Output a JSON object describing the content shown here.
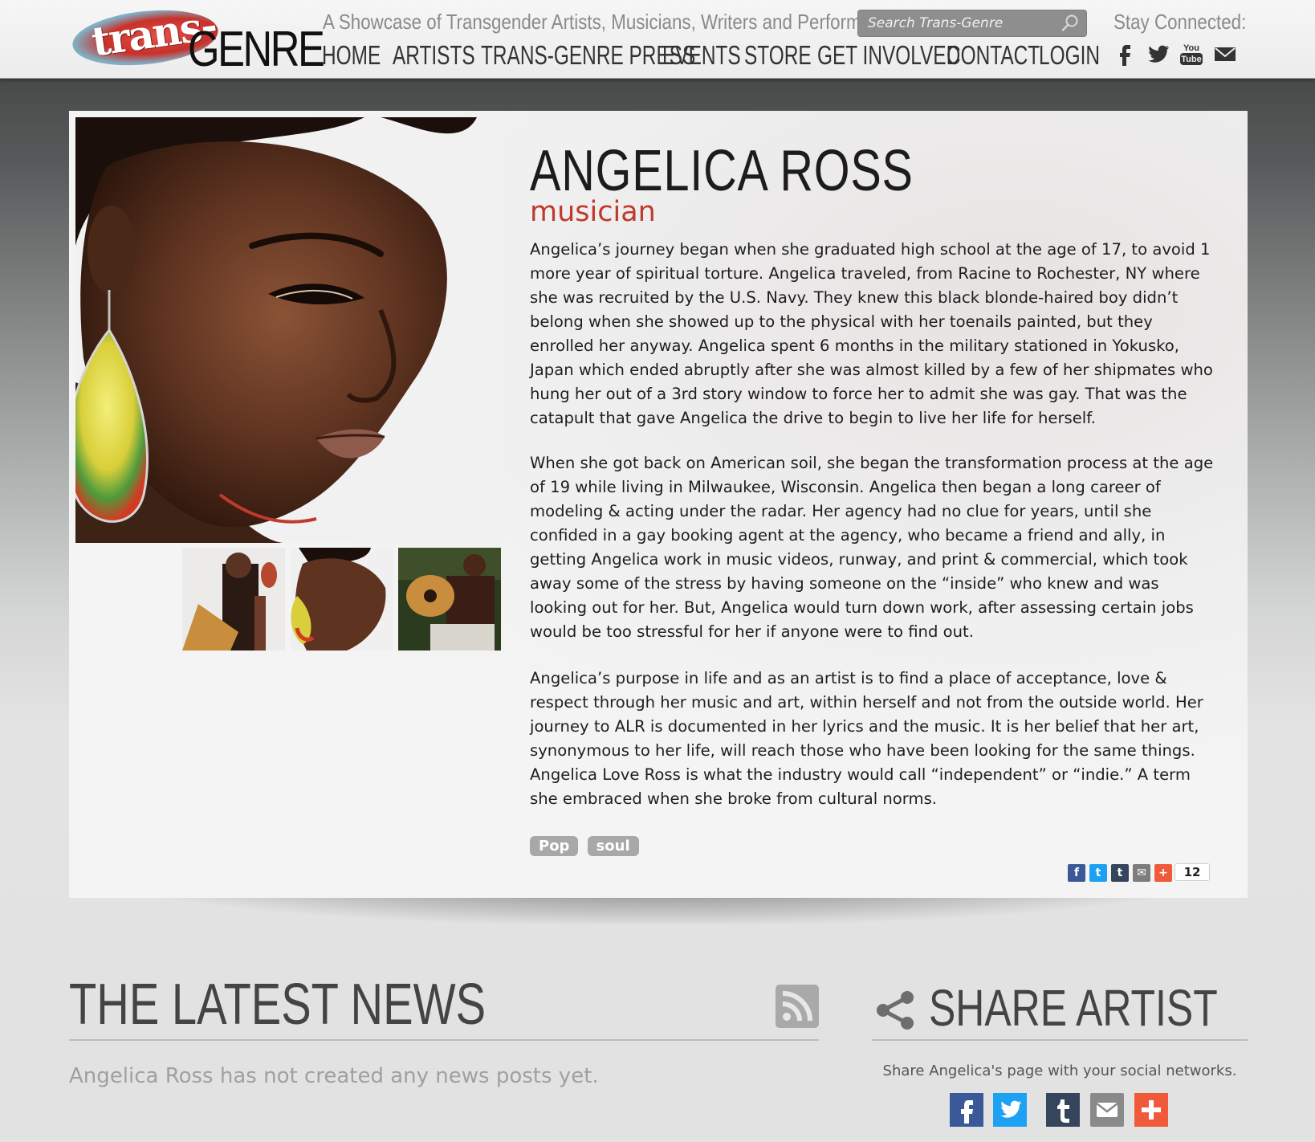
{
  "header": {
    "logo_alt": "trans-GENRE",
    "logo_text_trans": "trans-",
    "logo_text_genre": "GENRE",
    "tagline": "A Showcase of Transgender Artists, Musicians, Writers and Performers",
    "search_placeholder": "Search Trans-Genre",
    "stay_connected": "Stay Connected:",
    "nav": [
      {
        "label": "HOME"
      },
      {
        "label": "ARTISTS"
      },
      {
        "label": "TRANS-GENRE PRESS"
      },
      {
        "label": "EVENTS"
      },
      {
        "label": "STORE"
      },
      {
        "label": "GET INVOLVED"
      },
      {
        "label": "CONTACT"
      },
      {
        "label": "LOGIN"
      }
    ],
    "social_icons": [
      "facebook-icon",
      "twitter-icon",
      "youtube-icon",
      "email-icon"
    ]
  },
  "artist": {
    "name": "ANGELICA ROSS",
    "role": "musician",
    "bio": [
      "Angelica’s journey began when she graduated high school at the age of 17, to avoid 1 more year of spiritual torture. Angelica traveled, from Racine to Rochester, NY where she was recruited by the U.S. Navy. They knew this black blonde-haired boy didn’t belong when she showed up to the physical with her toenails painted, but they enrolled her anyway. Angelica spent 6 months in the military stationed in Yokusko, Japan which ended abruptly after she was almost killed by a few of her shipmates who hung her out of a 3rd story window to force her to admit she was gay. That was the catapult that gave Angelica the drive to begin to live her life for herself.",
      "When she got back on American soil, she began the transformation process at the age of 19 while living in Milwaukee, Wisconsin. Angelica then began a long career of modeling & acting under the radar. Her agency had no clue for years, until she confided in a gay booking agent at the agency, who became a friend and ally, in getting Angelica work in music videos, runway, and print & commercial, which took away some of the stress by having someone on the “inside” who knew and was looking out for her. But, Angelica would turn down work, after assessing certain jobs would be too stressful for her if anyone were to find out.",
      "Angelica’s purpose in life and as an artist is to find a place of acceptance, love & respect through her music and art, within herself and not from the outside world. Her journey to ALR is documented in her lyrics and the music. It is her belief that her art, synonymous to her life, will reach those who have been looking for the same things. Angelica Love Ross is what the industry would call “independent” or “indie.” A term she embraced when she broke from cultural norms."
    ],
    "tags": [
      "Pop",
      "soul"
    ],
    "share_count": "12",
    "share_buttons": [
      {
        "icon": "facebook-icon",
        "glyph": "f",
        "color": "#3b5998"
      },
      {
        "icon": "twitter-icon",
        "glyph": "t",
        "color": "#1da1f2"
      },
      {
        "icon": "tumblr-icon",
        "glyph": "t",
        "color": "#35465c"
      },
      {
        "icon": "email-icon",
        "glyph": "✉",
        "color": "#7d7d7d"
      },
      {
        "icon": "plus-icon",
        "glyph": "+",
        "color": "#f1593b"
      }
    ]
  },
  "news": {
    "title": "THE LATEST NEWS",
    "empty_message": "Angelica Ross has not created any news posts yet."
  },
  "share": {
    "title": "SHARE ARTIST",
    "description": "Share Angelica's page with your social networks.",
    "buttons": [
      {
        "icon": "facebook-icon",
        "color": "#3b5998"
      },
      {
        "icon": "twitter-icon",
        "color": "#1da1f2"
      },
      {
        "icon": "tumblr-icon",
        "color": "#35465c"
      },
      {
        "icon": "email-icon",
        "color": "#8a8a8a"
      },
      {
        "icon": "plus-icon",
        "color": "#f1593b"
      }
    ]
  }
}
